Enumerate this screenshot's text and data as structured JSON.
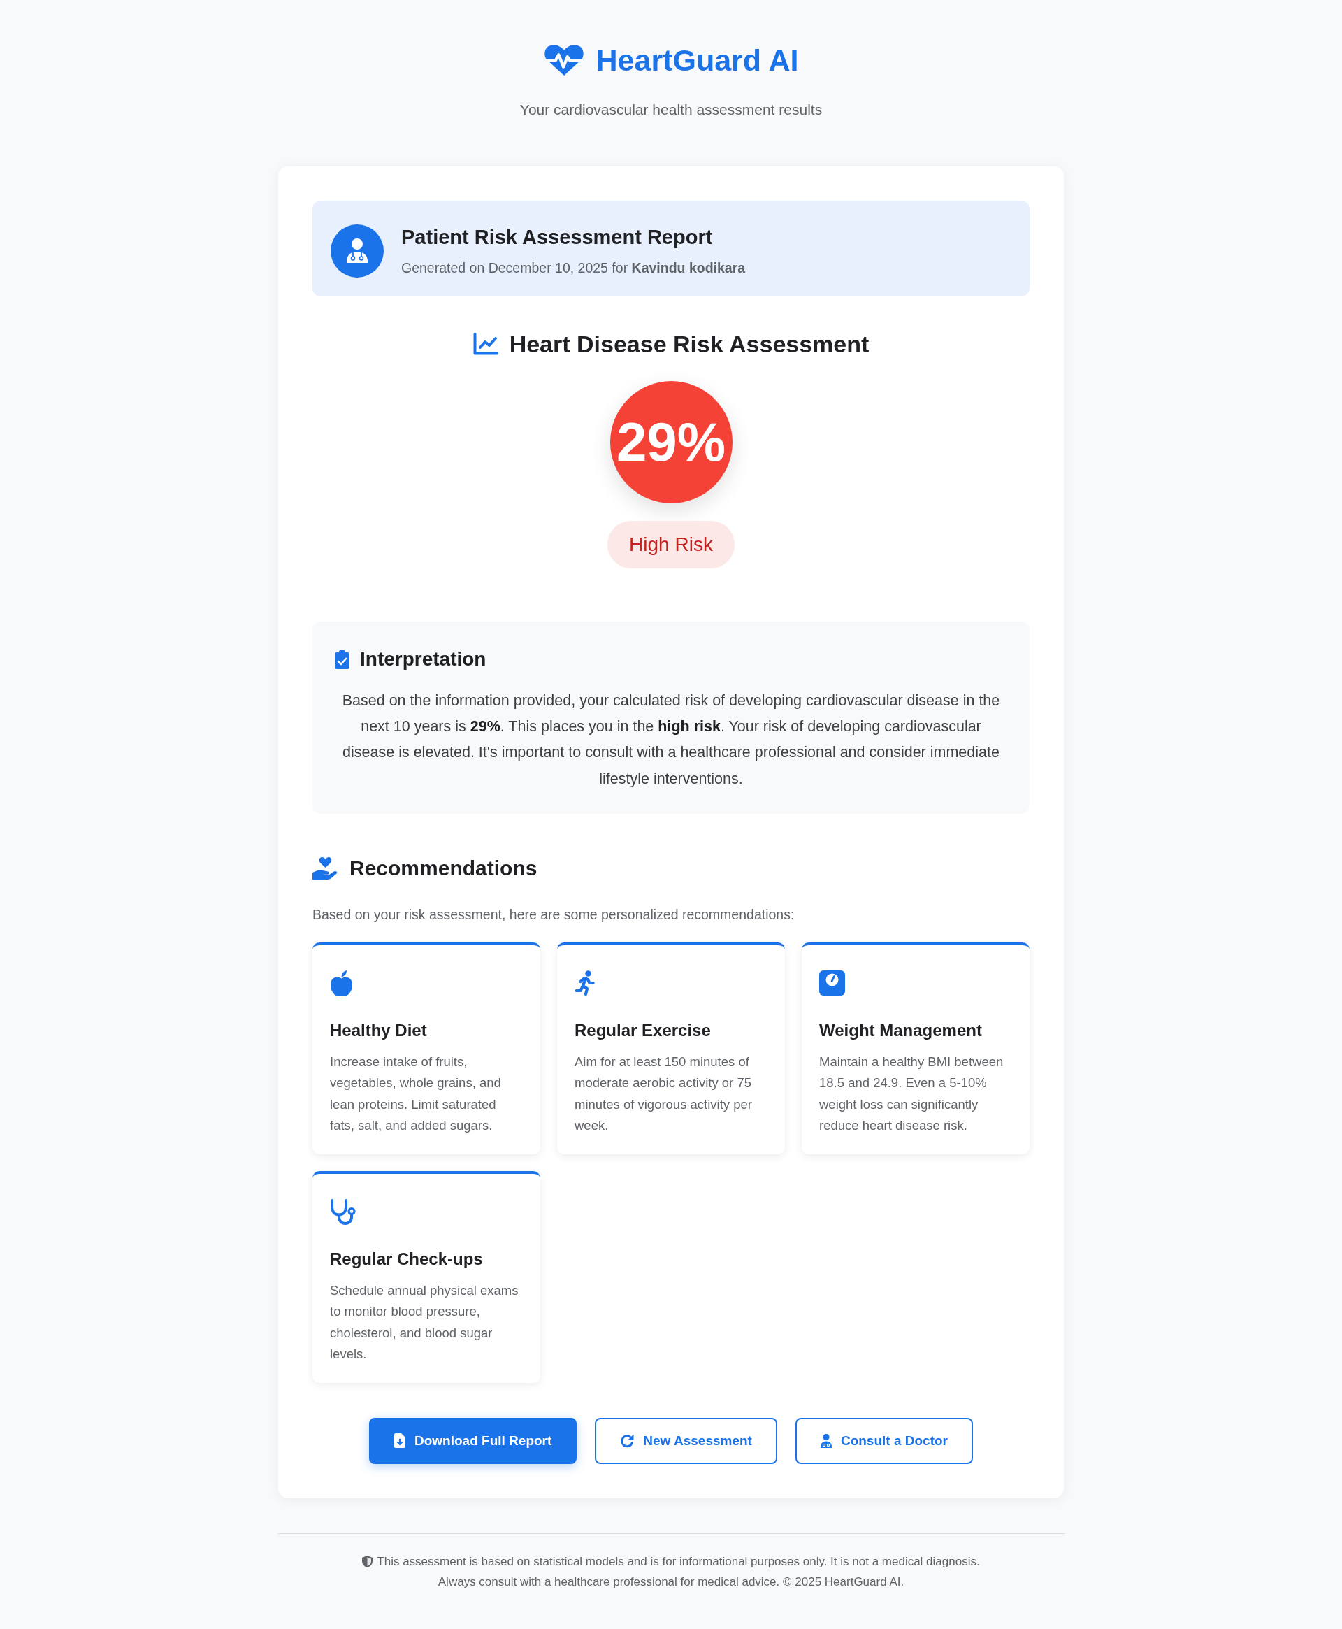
{
  "header": {
    "title": "HeartGuard AI",
    "subtitle": "Your cardiovascular health assessment results"
  },
  "patient_banner": {
    "title": "Patient Risk Assessment Report",
    "meta": "Generated on December 10, 2025 for **Kavindu kodikara**"
  },
  "risk": {
    "heading": "Heart Disease Risk Assessment",
    "score": "29%",
    "badge": "High Risk"
  },
  "interpretation": {
    "title": "Interpretation",
    "text": "Based on the information provided, your calculated risk of developing cardiovascular disease in the next 10 years is **29%**. This places you in the **high risk**. Your risk of developing cardiovascular disease is elevated. It's important to consult with a healthcare professional and consider immediate lifestyle interventions."
  },
  "recommendations": {
    "title": "Recommendations",
    "intro": "Based on your risk assessment, here are some personalized recommendations:",
    "items": [
      {
        "kind": "diet",
        "title": "Healthy Diet",
        "text": "Increase intake of fruits, vegetables, whole grains, and lean proteins. Limit saturated fats, salt, and added sugars."
      },
      {
        "kind": "exercise",
        "title": "Regular Exercise",
        "text": "Aim for at least 150 minutes of moderate aerobic activity or 75 minutes of vigorous activity per week."
      },
      {
        "kind": "weight",
        "title": "Weight Management",
        "text": "Maintain a healthy BMI between 18.5 and 24.9. Even a 5-10% weight loss can significantly reduce heart disease risk."
      },
      {
        "kind": "checkup",
        "title": "Regular Check-ups",
        "text": "Schedule annual physical exams to monitor blood pressure, cholesterol, and blood sugar levels."
      }
    ]
  },
  "actions": [
    {
      "kind": "download",
      "label": "Download Full Report",
      "primary": true
    },
    {
      "kind": "restart",
      "label": "New Assessment",
      "primary": false
    },
    {
      "kind": "consult",
      "label": "Consult a Doctor",
      "primary": false
    }
  ],
  "footer": {
    "lines": [
      "This assessment is based on statistical models and is for informational purposes only. It is not a medical diagnosis.",
      "Always consult with a healthcare professional for medical advice. © 2025 HeartGuard AI."
    ]
  }
}
